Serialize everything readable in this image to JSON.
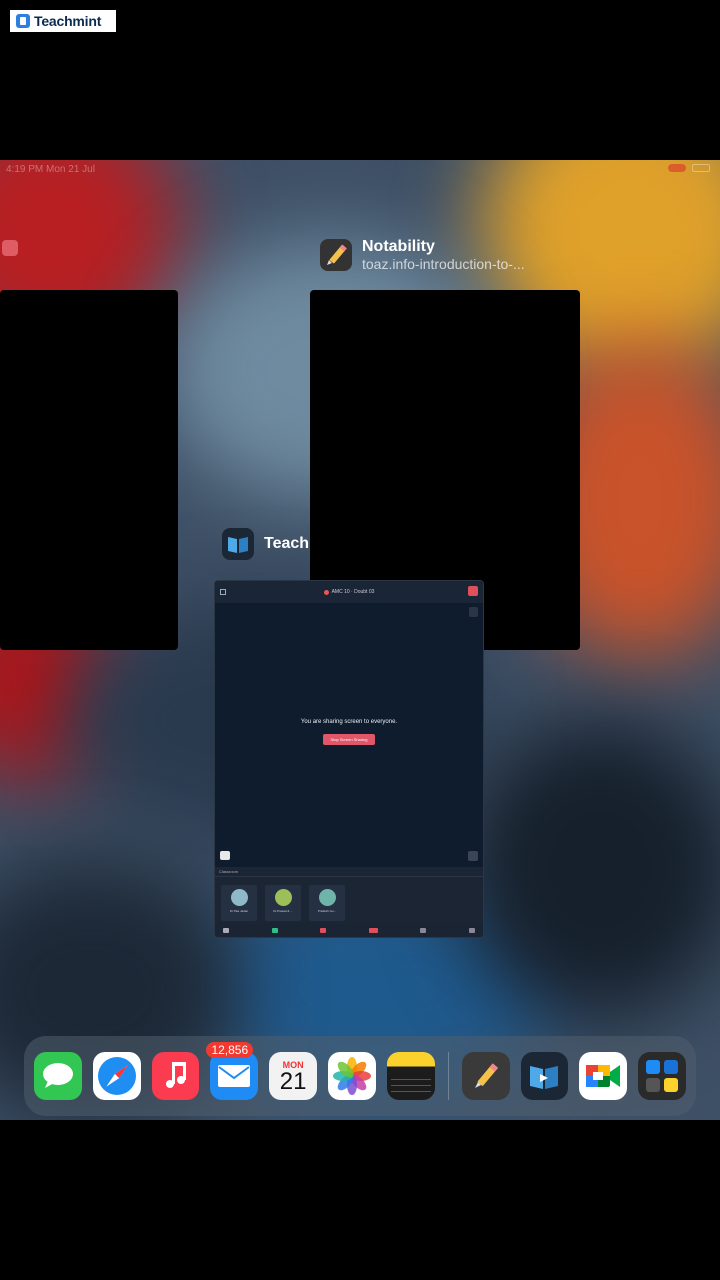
{
  "watermark": {
    "text": "Teachmint"
  },
  "status_bar": {
    "time": "4:19 PM  Mon 21 Jul"
  },
  "switcher": {
    "notability": {
      "title": "Notability",
      "subtitle": "toaz.info-introduction-to-..."
    },
    "teachmint": {
      "title": "Teach",
      "meeting_title": "AMC 10 · Doubt 03",
      "sharing_message": "You are sharing screen to everyone.",
      "stop_label": "Stop Screen Sharing",
      "participants_bar": "Classroom",
      "participants": [
        {
          "name": "Dr.Tika Jadan",
          "color": "#8fb8c8"
        },
        {
          "name": "Dr.Prasad & ...",
          "color": "#9cbf5a"
        },
        {
          "name": "Pratiksh Gu...",
          "color": "#6fb4a8"
        }
      ]
    }
  },
  "dock": {
    "apps": [
      {
        "name": "messages",
        "color": "#31c752"
      },
      {
        "name": "safari",
        "color": "#1e8ef2"
      },
      {
        "name": "music",
        "color": "#fb3b4f"
      },
      {
        "name": "mail",
        "color": "#1f8bf5",
        "badge": "12,856"
      },
      {
        "name": "calendar",
        "dow": "MON",
        "day": "21"
      },
      {
        "name": "photos"
      },
      {
        "name": "notes"
      },
      {
        "name": "notability",
        "color": "#3a3a3a"
      },
      {
        "name": "teachmint",
        "color": "#2a78c8"
      },
      {
        "name": "google-meet",
        "color": "#ffffff"
      },
      {
        "name": "app-library",
        "color": "#2a2a2a"
      }
    ]
  }
}
